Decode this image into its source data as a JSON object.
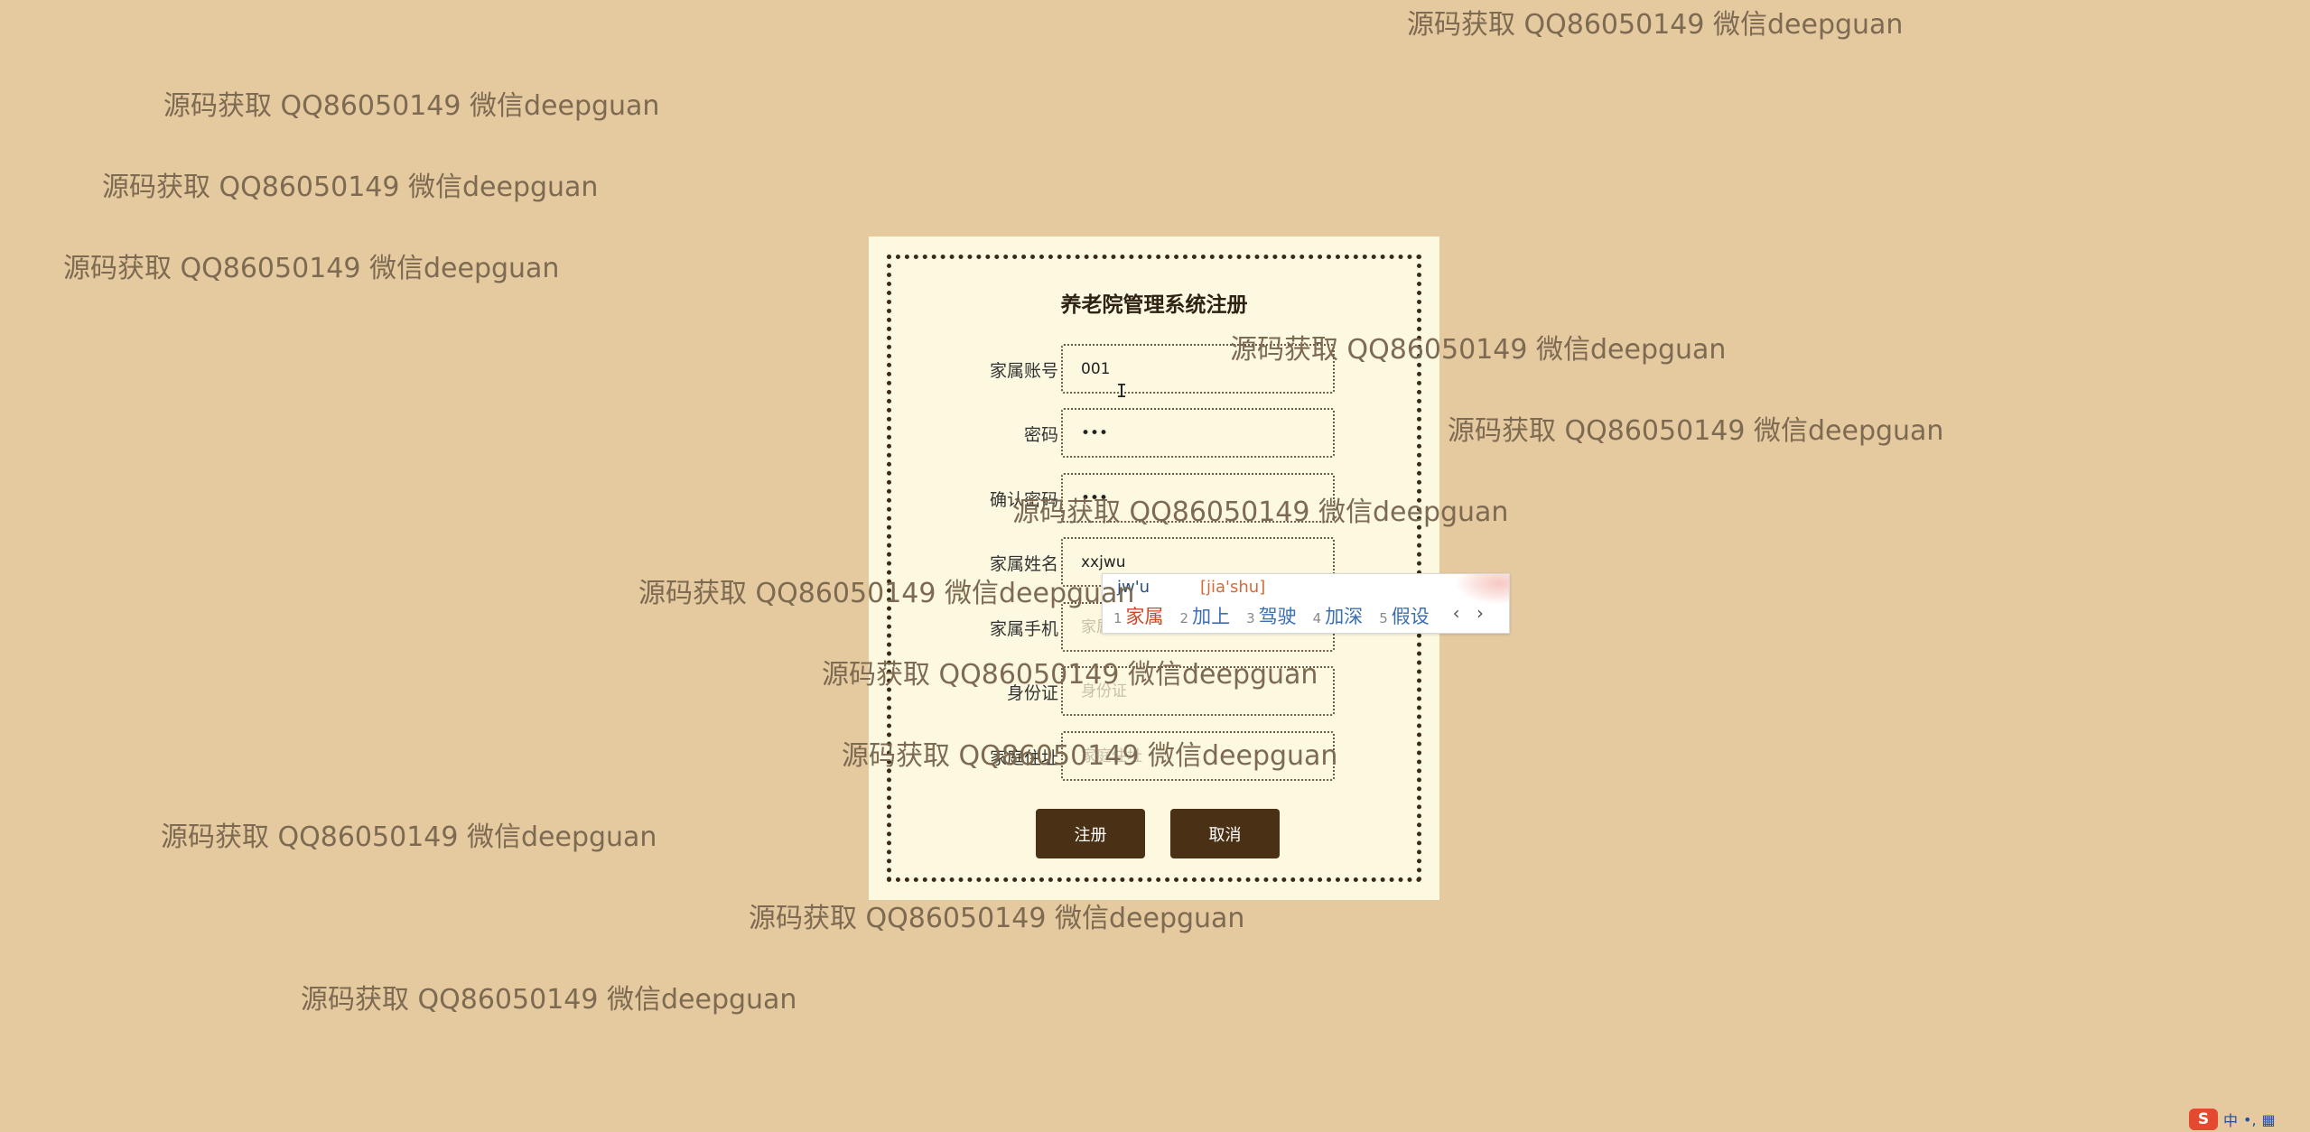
{
  "watermark_text": "源码获取 QQ86050149 微信deepguan",
  "form": {
    "title": "养老院管理系统注册",
    "fields": [
      {
        "label": "家属账号",
        "value": "001",
        "placeholder": "",
        "type": "text"
      },
      {
        "label": "密码",
        "value": "•••",
        "placeholder": "",
        "type": "text"
      },
      {
        "label": "确认密码",
        "value": "•••",
        "placeholder": "",
        "type": "text"
      },
      {
        "label": "家属姓名",
        "value": "xxjwu",
        "placeholder": "",
        "type": "text"
      },
      {
        "label": "家属手机",
        "value": "",
        "placeholder": "家属手机",
        "type": "text"
      },
      {
        "label": "身份证",
        "value": "",
        "placeholder": "身份证",
        "type": "text"
      },
      {
        "label": "家庭住址",
        "value": "",
        "placeholder": "家庭住址",
        "type": "text"
      }
    ],
    "register_label": "注册",
    "cancel_label": "取消"
  },
  "ime": {
    "composition": "jw'u",
    "pinyin": "[jia'shu]",
    "candidates": [
      {
        "num": "1",
        "text": "家属"
      },
      {
        "num": "2",
        "text": "加上"
      },
      {
        "num": "3",
        "text": "驾驶"
      },
      {
        "num": "4",
        "text": "加深"
      },
      {
        "num": "5",
        "text": "假设"
      }
    ],
    "nav": "‹ ›"
  },
  "tray": {
    "logo": "S",
    "mode": "中",
    "punct": "•,"
  },
  "colors": {
    "background": "#e5c99f",
    "panel": "#fdf9e0",
    "button": "#4a3116",
    "watermark": "#7d6a52"
  }
}
